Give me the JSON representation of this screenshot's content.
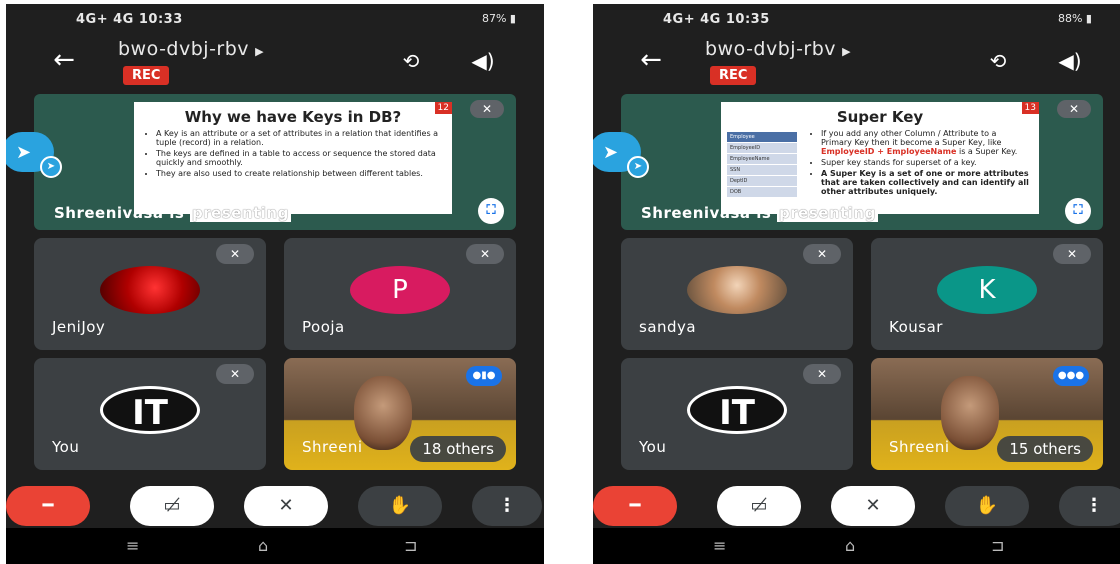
{
  "screens": [
    {
      "status": {
        "time": "10:33",
        "net": "4G+ 4G",
        "battery": "87%"
      },
      "title": "bwo-dvbj-rbv",
      "rec": "REC",
      "slide": {
        "title": "Why we have Keys in DB?",
        "bullets": [
          "A Key is an attribute or a set of attributes in a relation that identifies a tuple (record) in a relation.",
          "The keys are defined in a table to access or sequence the stored data quickly and smoothly.",
          "They are also used to create relationship between different tables."
        ],
        "number": "12"
      },
      "presenter": {
        "name": "Shreenivasa is",
        "tail": "presenting"
      },
      "tiles": [
        {
          "name": "JeniJoy"
        },
        {
          "name": "Pooja",
          "initial": "P"
        },
        {
          "name": "You",
          "initial": "IT"
        },
        {
          "name": "Shreeni",
          "others": "18 others"
        }
      ]
    },
    {
      "status": {
        "time": "10:35",
        "net": "4G+ 4G",
        "battery": "88%"
      },
      "title": "bwo-dvbj-rbv",
      "rec": "REC",
      "slide": {
        "title": "Super Key",
        "b1": "If you add any other Column / Attribute to a Primary Key then it become a Super Key, like",
        "b1_red": "EmployeeID + EmployeeName",
        "b1_tail": "is a Super Key.",
        "b2": "Super key stands for superset of a key.",
        "b3": "A Super Key is a set of one or more attributes that are taken collectively and can identify all other attributes uniquely.",
        "table": [
          "Employee",
          "EmployeeID",
          "EmployeeName",
          "SSN",
          "DeptID",
          "DOB"
        ],
        "number": "13"
      },
      "presenter": {
        "name": "Shreenivasa is",
        "tail": "presenting"
      },
      "tiles": [
        {
          "name": "sandya"
        },
        {
          "name": "Kousar",
          "initial": "K"
        },
        {
          "name": "You",
          "initial": "IT"
        },
        {
          "name": "Shreeni",
          "others": "15 others"
        }
      ]
    }
  ],
  "icons": {
    "back": "arrow-left-icon",
    "switch_camera": "camera-switch-icon",
    "speaker": "speaker-icon",
    "mute": "mic-off-icon",
    "end_call": "phone-end-icon",
    "camera_off": "camera-off-icon",
    "hand": "raise-hand-icon",
    "more": "more-vert-icon",
    "fullscreen": "fullscreen-icon",
    "telegram": "telegram-icon"
  }
}
